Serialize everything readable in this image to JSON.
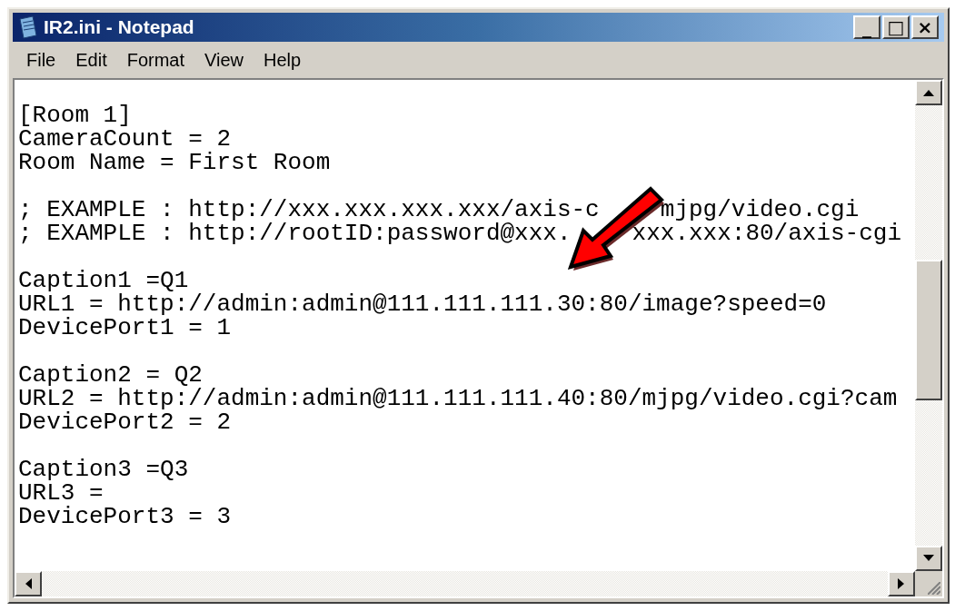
{
  "window": {
    "title": "IR2.ini - Notepad",
    "controls": [
      "_",
      "□",
      "×"
    ]
  },
  "menu": [
    "File",
    "Edit",
    "Format",
    "View",
    "Help"
  ],
  "document": {
    "blocks": [
      [
        [
          "[Room 1]"
        ],
        [
          "CameraCount = 2"
        ],
        [
          "Room Name = First Room"
        ]
      ],
      [
        [
          "; EXAMPLE : http://xxx.xxx.xxx.xxx/axis-c",
          "mjpg/video.cgi"
        ],
        [
          "; EXAMPLE : http://rootID:password@xxx.",
          "xxx.xxx:80/axis-cgi"
        ]
      ],
      [
        [
          "Caption1 =Q1"
        ],
        [
          "URL1 = http://admin:admin@111.111.111.30:80/image?speed=0"
        ],
        [
          "DevicePort1 = 1"
        ]
      ],
      [
        [
          "Caption2 = Q2"
        ],
        [
          "URL2 = http://admin:admin@111.111.111.40:80/mjpg/video.cgi?cam"
        ],
        [
          "DevicePort2 = 2"
        ]
      ],
      [
        [
          "Caption3 =Q3"
        ],
        [
          "URL3 ="
        ],
        [
          "DevicePort3 = 3"
        ]
      ]
    ]
  }
}
